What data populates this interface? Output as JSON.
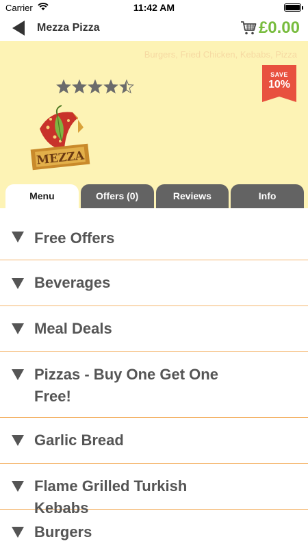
{
  "status_bar": {
    "carrier": "Carrier",
    "time": "11:42 AM"
  },
  "nav": {
    "title": "Mezza Pizza",
    "cart_total": "£0.00"
  },
  "restaurant": {
    "cuisines": "Burgers, Fried Chicken, Kebabs, Pizza",
    "rating": 4.5,
    "rating_max": 5,
    "save_badge": {
      "label": "SAVE",
      "value": "10%"
    },
    "logo_text": "MEZZA"
  },
  "tabs": [
    {
      "label": "Menu"
    },
    {
      "label": "Offers (0)"
    },
    {
      "label": "Reviews"
    },
    {
      "label": "Info"
    }
  ],
  "categories": [
    {
      "label": "Free Offers"
    },
    {
      "label": "Beverages"
    },
    {
      "label": "Meal Deals"
    },
    {
      "label": "Pizzas - Buy One Get One Free!"
    },
    {
      "label": "Garlic Bread"
    },
    {
      "label": "Flame Grilled Turkish Kebabs"
    },
    {
      "label": "Burgers"
    }
  ],
  "colors": {
    "accent_green": "#78bc3e",
    "banner_bg": "#fdf3b5",
    "badge_red": "#e8513f",
    "tab_gray": "#636363",
    "divider": "#f4b46a"
  }
}
